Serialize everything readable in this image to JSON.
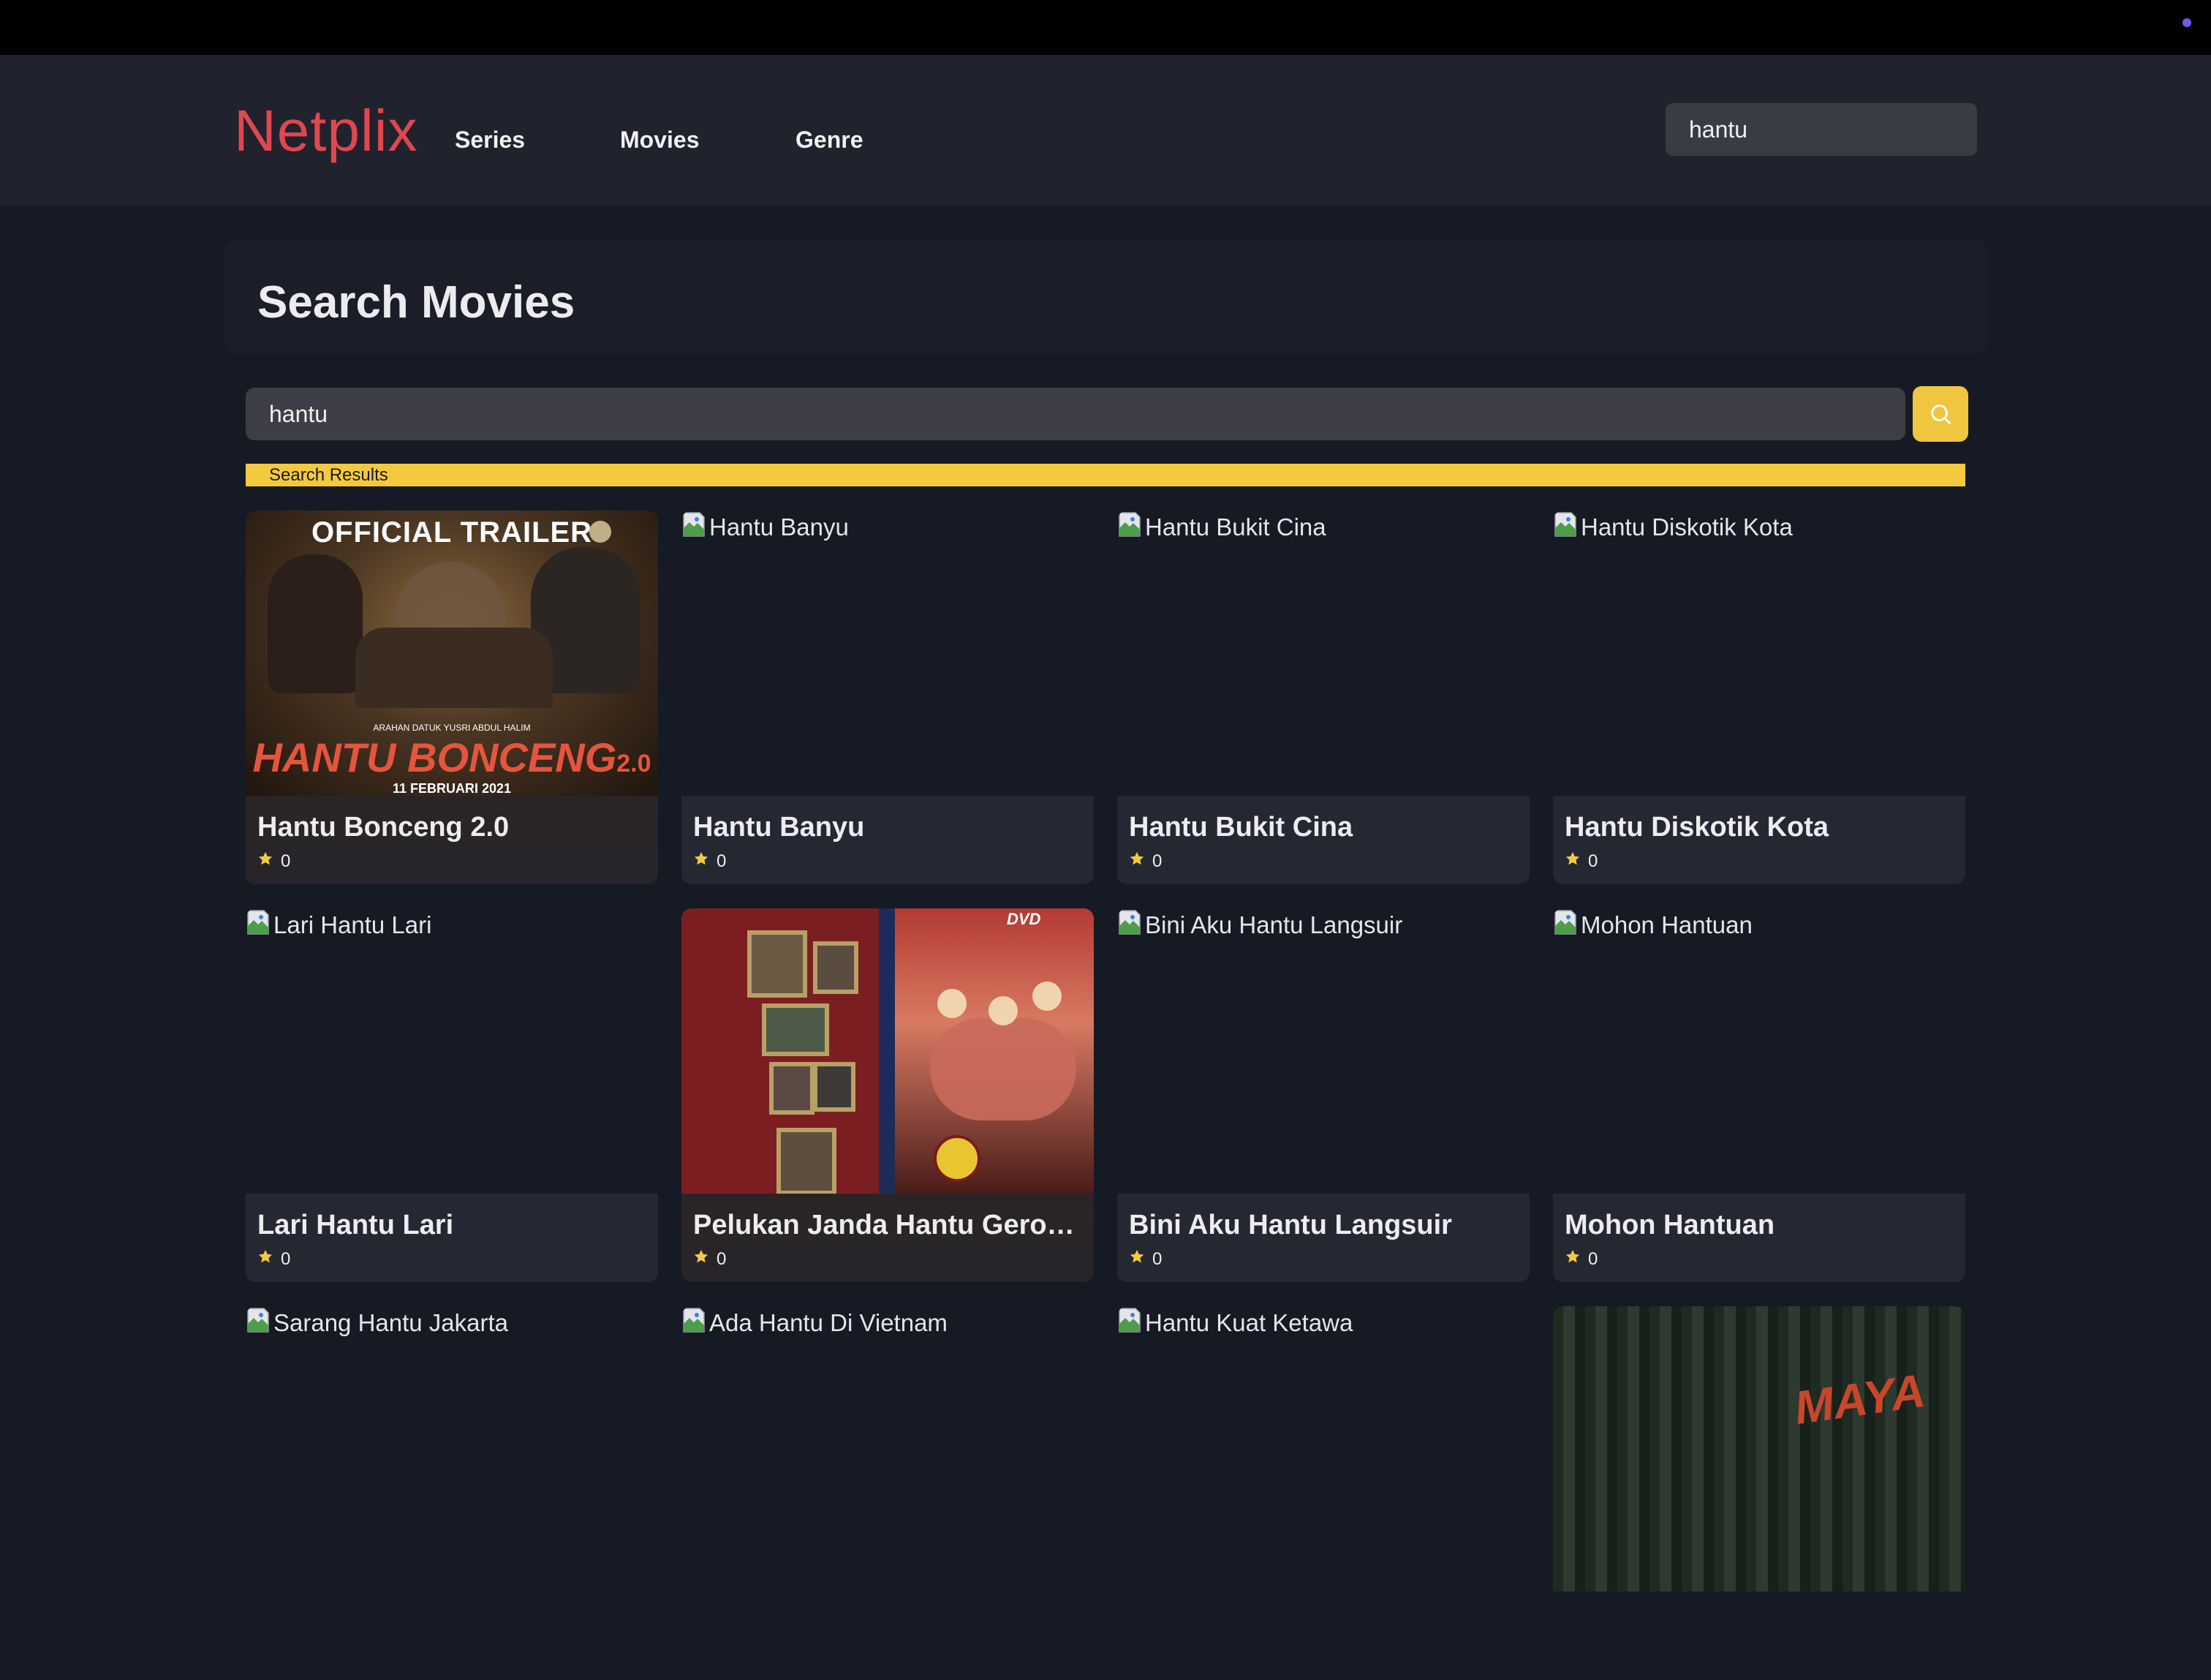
{
  "header": {
    "logo": "Netplix",
    "nav": [
      "Series",
      "Movies",
      "Genre"
    ],
    "search_value": "hantu"
  },
  "page": {
    "title": "Search Movies",
    "search_value": "hantu",
    "results_label": "Search Results",
    "accent_color": "#f3c93f",
    "logo_color": "#e0474e"
  },
  "movies": [
    {
      "title": "Hantu Bonceng 2.0",
      "rating": "0",
      "poster_alt": "Hantu Bonceng 2.0",
      "poster_loaded": true,
      "poster_text": {
        "top": "OFFICIAL TRAILER",
        "credit": "ARAHAN DATUK YUSRI ABDUL HALIM",
        "logo": "HANTU BONCENG",
        "logo_suffix": "2.0",
        "date": "11 FEBRUARI 2021"
      }
    },
    {
      "title": "Hantu Banyu",
      "rating": "0",
      "poster_alt": "Hantu Banyu",
      "poster_loaded": false
    },
    {
      "title": "Hantu Bukit Cina",
      "rating": "0",
      "poster_alt": "Hantu Bukit Cina",
      "poster_loaded": false
    },
    {
      "title": "Hantu Diskotik Kota",
      "rating": "0",
      "poster_alt": "Hantu Diskotik Kota",
      "poster_loaded": false
    },
    {
      "title": "Lari Hantu Lari",
      "rating": "0",
      "poster_alt": "Lari Hantu Lari",
      "poster_loaded": false
    },
    {
      "title": "Pelukan Janda Hantu Geron…",
      "rating": "0",
      "poster_alt": "Pelukan Janda Hantu Gerondong",
      "poster_loaded": true,
      "poster_text": {
        "dvd": "DVD"
      }
    },
    {
      "title": "Bini Aku Hantu Langsuir",
      "rating": "0",
      "poster_alt": "Bini Aku Hantu Langsuir",
      "poster_loaded": false
    },
    {
      "title": "Mohon Hantuan",
      "rating": "0",
      "poster_alt": "Mohon Hantuan",
      "poster_loaded": false
    },
    {
      "title": "",
      "rating": "",
      "poster_alt": "Sarang Hantu Jakarta",
      "poster_loaded": false
    },
    {
      "title": "",
      "rating": "",
      "poster_alt": "Ada Hantu Di Vietnam",
      "poster_loaded": false
    },
    {
      "title": "",
      "rating": "",
      "poster_alt": "Hantu Kuat Ketawa",
      "poster_loaded": false
    },
    {
      "title": "",
      "rating": "",
      "poster_alt": "",
      "poster_loaded": true,
      "poster_text": {
        "logo": "MAYA"
      }
    }
  ]
}
